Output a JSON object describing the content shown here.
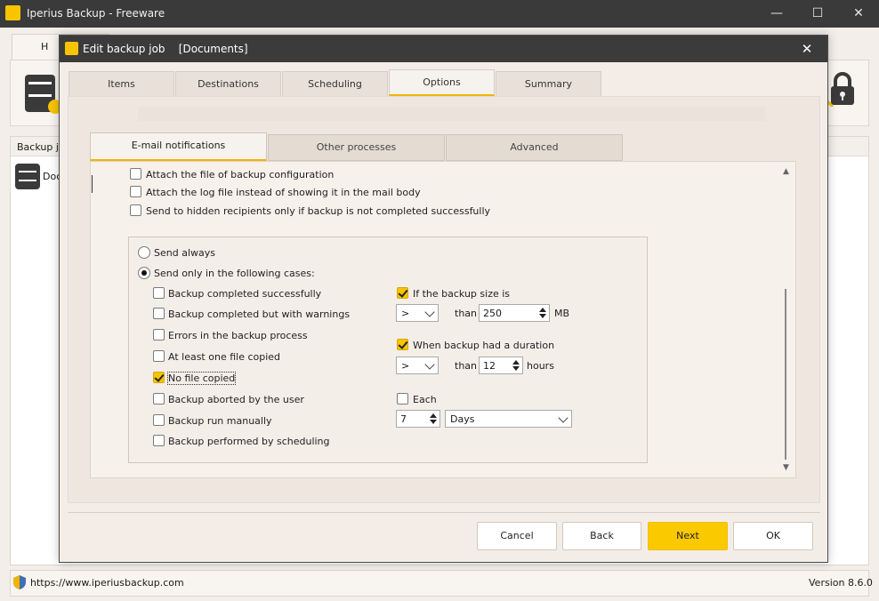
{
  "app": {
    "title": "Iperius Backup - Freeware",
    "home_tab": "H",
    "backup_jobs_header": "Backup jo",
    "job_item": "Doc",
    "status_url": "https://www.iperiusbackup.com",
    "version": "Version 8.6.0",
    "window_controls": {
      "minimize": "—",
      "maximize": "☐",
      "close": "✕"
    }
  },
  "dialog": {
    "title": "Edit backup job    [Documents]",
    "close": "✕",
    "tabs": [
      "Items",
      "Destinations",
      "Scheduling",
      "Options",
      "Summary"
    ],
    "active_tab": "Options",
    "subtabs": [
      "E-mail notifications",
      "Other processes",
      "Advanced"
    ],
    "active_subtab": "E-mail notifications",
    "top_options": [
      {
        "label": "Attach the file of backup configuration",
        "checked": false
      },
      {
        "label": "Attach the log file instead of showing it in the mail body",
        "checked": false
      },
      {
        "label": "Send to hidden recipients only if backup is not completed successfully",
        "checked": false
      }
    ],
    "send_mode": {
      "always": "Send always",
      "cases": "Send only in the following cases:",
      "selected": "cases"
    },
    "cases": [
      {
        "label": "Backup completed successfully",
        "checked": false
      },
      {
        "label": "Backup completed but with warnings",
        "checked": false
      },
      {
        "label": "Errors in the backup process",
        "checked": false
      },
      {
        "label": "At least one file copied",
        "checked": false
      },
      {
        "label": "No file copied",
        "checked": true
      },
      {
        "label": "Backup aborted by the user",
        "checked": false
      },
      {
        "label": "Backup run manually",
        "checked": false
      },
      {
        "label": "Backup performed by scheduling",
        "checked": false
      }
    ],
    "size_rule": {
      "label": "If the backup size is",
      "checked": true,
      "operator": ">",
      "than": "than",
      "value": "250",
      "unit": "MB"
    },
    "duration_rule": {
      "label": "When backup had a duration",
      "checked": true,
      "operator": ">",
      "than": "than",
      "value": "12",
      "unit": "hours"
    },
    "each_rule": {
      "label": "Each",
      "checked": false,
      "value": "7",
      "period": "Days"
    },
    "buttons": {
      "cancel": "Cancel",
      "back": "Back",
      "next": "Next",
      "ok": "OK"
    }
  },
  "colors": {
    "accent": "#f8c400",
    "titlebar": "#3a3a3a",
    "dialog_bg": "#f4ede7"
  }
}
